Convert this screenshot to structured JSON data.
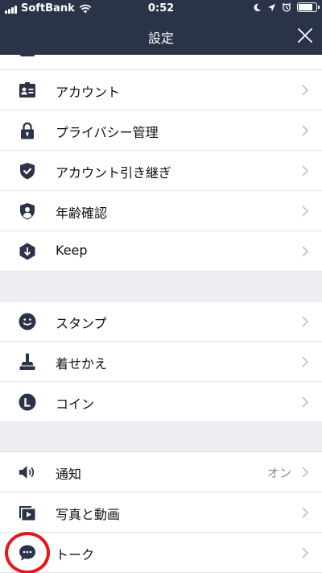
{
  "status_bar": {
    "carrier": "SoftBank",
    "time": "0:52"
  },
  "header": {
    "title": "設定"
  },
  "settings": {
    "account": {
      "label": "アカウント",
      "icon": "id-card-icon"
    },
    "privacy": {
      "label": "プライバシー管理",
      "icon": "lock-icon"
    },
    "transfer": {
      "label": "アカウント引き継ぎ",
      "icon": "shield-check-icon"
    },
    "age": {
      "label": "年齢確認",
      "icon": "shield-user-icon"
    },
    "keep": {
      "label": "Keep",
      "icon": "keep-icon"
    },
    "stamp": {
      "label": "スタンプ",
      "icon": "smiley-icon"
    },
    "theme": {
      "label": "着せかえ",
      "icon": "brush-icon"
    },
    "coin": {
      "label": "コイン",
      "icon": "coin-icon"
    },
    "notify": {
      "label": "通知",
      "value": "オン",
      "icon": "speaker-icon"
    },
    "media": {
      "label": "写真と動画",
      "icon": "play-video-icon"
    },
    "talk": {
      "label": "トーク",
      "icon": "chat-bubble-icon"
    }
  },
  "colors": {
    "header_bg": "#2b3349",
    "icon": "#2b3349",
    "section_gap": "#eeeef2",
    "annotation": "#e8161c"
  }
}
